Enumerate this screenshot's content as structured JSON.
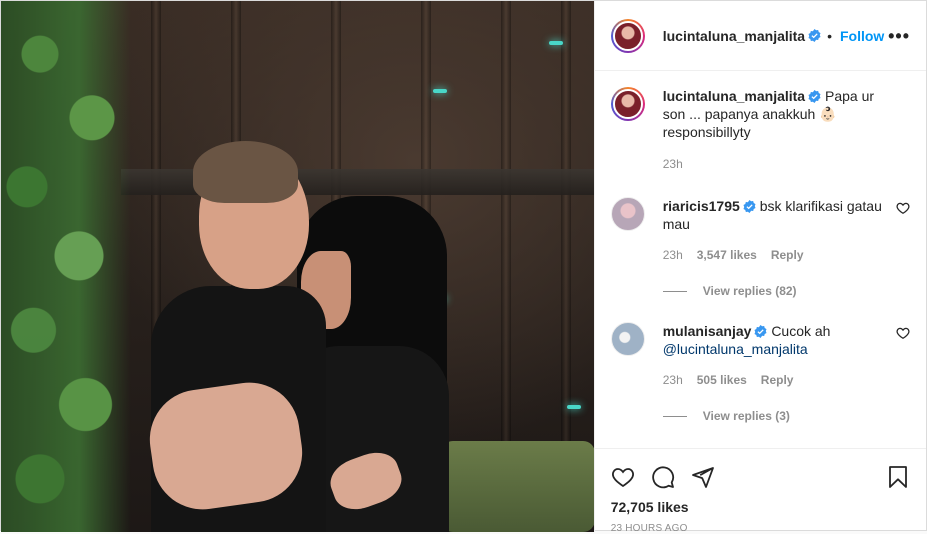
{
  "post": {
    "author": "lucintaluna_manjalita",
    "follow_label": "Follow",
    "dot": "•",
    "more": "•••"
  },
  "caption": {
    "username": "lucintaluna_manjalita",
    "text": "Papa ur son ... papanya anakkuh 👶🏻 responsibillyty",
    "time": "23h"
  },
  "comments": [
    {
      "username": "riaricis1795",
      "text": "bsk klarifikasi gatau mau",
      "time": "23h",
      "likes": "3,547 likes",
      "reply": "Reply",
      "view_replies": "View replies (82)"
    },
    {
      "username": "mulanisanjay",
      "text": "Cucok ah",
      "mention": "@lucintaluna_manjalita",
      "time": "23h",
      "likes": "505 likes",
      "reply": "Reply",
      "view_replies": "View replies (3)"
    }
  ],
  "footer": {
    "likes": "72,705 likes",
    "posted": "23 HOURS AGO"
  },
  "colors": {
    "accent": "#0095f6",
    "verified": "#3897f0",
    "muted": "#8e8e8e"
  },
  "icons": [
    "heart-icon",
    "comment-icon",
    "share-icon",
    "bookmark-icon",
    "verified-badge-icon",
    "more-options-icon"
  ]
}
